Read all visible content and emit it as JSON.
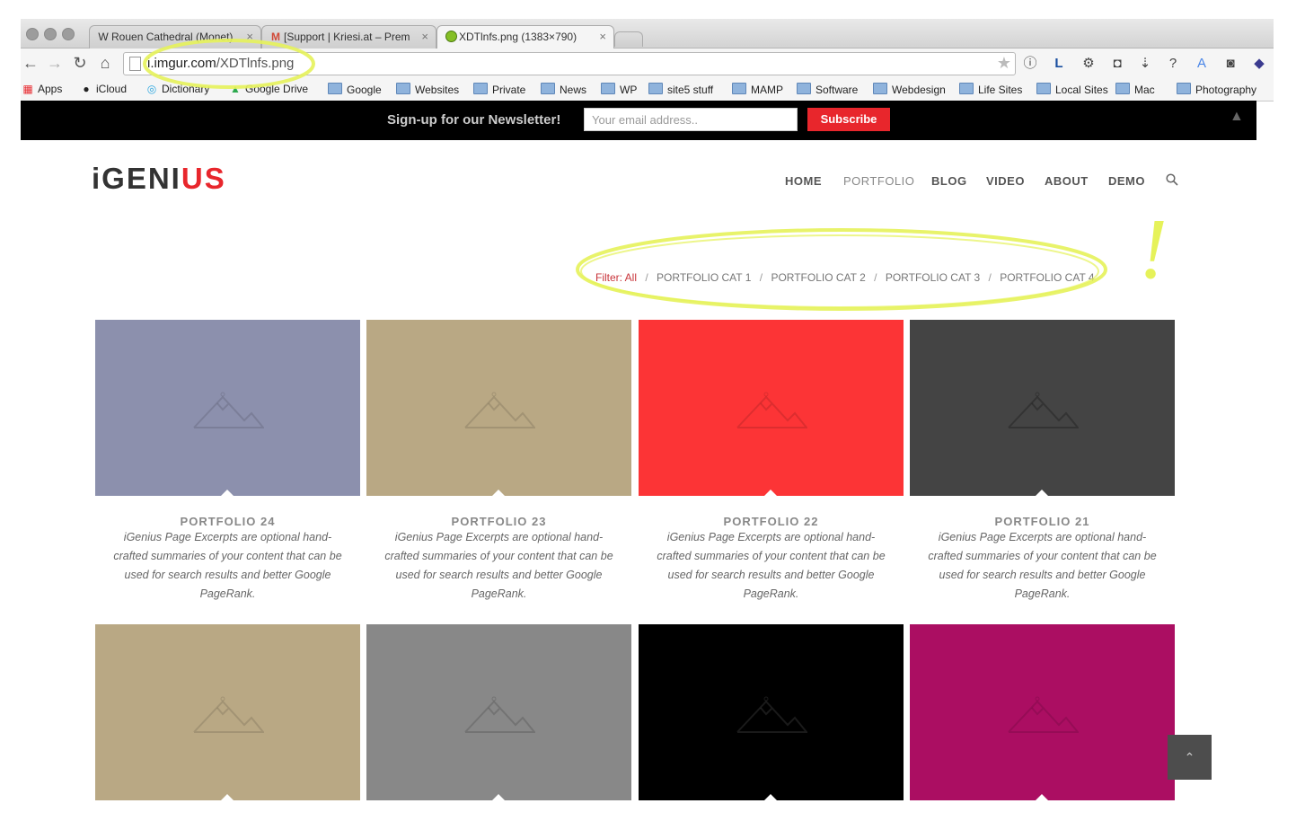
{
  "browser": {
    "tabs": [
      {
        "icon": "W",
        "title": "Rouen Cathedral (Monet)",
        "close": "×"
      },
      {
        "icon": "M",
        "title": "[Support | Kriesi.at – Prem",
        "close": "×"
      },
      {
        "icon": "",
        "title": "XDTlnfs.png (1383×790)",
        "close": "×"
      }
    ],
    "url_host": "i.imgur.com",
    "url_path": "/XDTlnfs.png",
    "bookmarks": [
      "Apps",
      "iCloud",
      "Dictionary",
      "Google Drive",
      "Google",
      "Websites",
      "Private",
      "News",
      "WP",
      "site5 stuff",
      "MAMP",
      "Software",
      "Webdesign",
      "Life Sites",
      "Local Sites",
      "Mac",
      "Photography"
    ]
  },
  "newsletter": {
    "label": "Sign-up for our Newsletter!",
    "placeholder": "Your email address..",
    "button": "Subscribe",
    "close": "▲"
  },
  "logo": {
    "part1": "iGENI",
    "part2": "US"
  },
  "nav": [
    "HOME",
    "PORTFOLIO",
    "BLOG",
    "VIDEO",
    "ABOUT",
    "DEMO"
  ],
  "filter": {
    "label": "Filter:",
    "all": "All",
    "cats": [
      "PORTFOLIO CAT 1",
      "PORTFOLIO CAT 2",
      "PORTFOLIO CAT 3",
      "PORTFOLIO CAT 4"
    ],
    "separator": "/"
  },
  "annotation": {
    "mark": "!",
    "color": "#e6f25a"
  },
  "portfolio": [
    {
      "title": "PORTFOLIO 24",
      "excerpt": "iGenius Page Excerpts are optional hand-crafted summaries of your content that can be used for search results and better Google PageRank.",
      "color": "#8c90ad"
    },
    {
      "title": "PORTFOLIO 23",
      "excerpt": "iGenius Page Excerpts are optional hand-crafted summaries of your content that can be used for search results and better Google PageRank.",
      "color": "#b9a884"
    },
    {
      "title": "PORTFOLIO 22",
      "excerpt": "iGenius Page Excerpts are optional hand-crafted summaries of your content that can be used for search results and better Google PageRank.",
      "color": "#fc3436"
    },
    {
      "title": "PORTFOLIO 21",
      "excerpt": "iGenius Page Excerpts are optional hand-crafted summaries of your content that can be used for search results and better Google PageRank.",
      "color": "#444444"
    },
    {
      "color": "#b9a884"
    },
    {
      "color": "#888888"
    },
    {
      "color": "#000000"
    },
    {
      "color": "#ab0e62"
    }
  ],
  "scroll_top": "⌃"
}
